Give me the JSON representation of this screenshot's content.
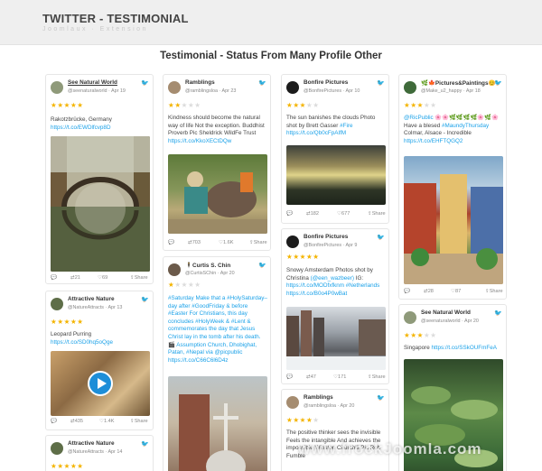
{
  "app": {
    "title": "TWITTER - TESTIMONIAL",
    "subtitle": "Joomlaux · Extension"
  },
  "heading": "Testimonial - Status From Many Profile Other",
  "cards": {
    "c1": {
      "name": "See Natural World",
      "handle": "@seenaturalworld",
      "date": "Apr 19",
      "stars": "★★★★★",
      "text": "Rakotzbrücke, Germany",
      "link": "https://t.co/EWDlfcvp8D",
      "retweets": "21",
      "likes": "69",
      "share": "Share"
    },
    "c2": {
      "name": "Attractive Nature",
      "handle": "@NatureAttracts",
      "date": "Apr 13",
      "stars": "★★★★★",
      "text": "Leopard Purring",
      "link": "https://t.co/SD0hq5oQge",
      "retweets": "435",
      "likes": "1.4K",
      "share": "Share"
    },
    "c3": {
      "name": "Attractive Nature",
      "handle": "@NatureAttracts",
      "date": "Apr 14",
      "stars": "★★★★★"
    },
    "c4": {
      "name": "Ramblings",
      "handle": "@ramblingsloa",
      "date": "Apr 23",
      "stars_on": "★★",
      "stars_off": "★★★",
      "text": "Kindness should become the natural way of life Not the exception. Buddhist Proverb Pic Sheldrick WildFe Trust",
      "link": "https://t.co/KkoXECtDQw",
      "retweets": "703",
      "likes": "1.6K",
      "share": "Share"
    },
    "c5": {
      "name": "Curtis S. Chin",
      "handle": "@CurtisSChin",
      "date": "Apr 20",
      "stars_on": "★",
      "stars_off": "★★★★",
      "text_a": "#Saturday Make that a #HolySaturday– day after #GoodFriday & before #Easter For Christians, this day concludes #HolyWeek & #Lent & commemorates the day that Jesus Christ lay in the tomb after his death. 🎬 Assumption Church, Dhobighat, Patan, #Nepal ",
      "text_b": "via @picpublic",
      "link": "https://t.co/C66C6l6D4z"
    },
    "c6": {
      "name": "Bonfire Pictures",
      "handle": "@BonfirePictures",
      "date": "Apr 10",
      "stars_on": "★★★",
      "stars_off": "★★",
      "text": "The sun banishes the clouds Photo shot by Brett Gasser ",
      "text_link": "#Fire",
      "link": "https://t.co/Qb0cFpAIfM",
      "retweets": "182",
      "likes": "677",
      "share": "Share"
    },
    "c7": {
      "name": "Bonfire Pictures",
      "handle": "@BonfirePictures",
      "date": "Apr 9",
      "stars": "★★★★★",
      "text": "Snowy Amsterdam Photos shot by Christina ",
      "text_link": "(@een_wazbeer)",
      "text_mid": " IG: ",
      "link": "https://t.co/MODfxfknm #Netherlands https://t.co/B0o4P0wBat",
      "retweets": "47",
      "likes": "171",
      "share": "Share"
    },
    "c8": {
      "name": "Ramblings",
      "handle": "@ramblingsloa",
      "date": "Apr 20",
      "stars_on": "★★★★",
      "stars_off": "★",
      "text": "The positive thinker sees the invisible Feels the intangible And achieves the impossible Winston Churchill Pic Rob Fumble"
    },
    "c9": {
      "name": "🌿🍁Pictures&Paintings😊",
      "handle": "@Make_u2_happy",
      "date": "Apr 18",
      "stars_on": "★★★",
      "stars_off": "★★",
      "text_a": "@RicPublic ",
      "text_b": "🌸🌸🌿🌿🌿🌿🌸🌿🌸",
      "text_c": " Have a blesed ",
      "text_d": "#MaundyThursday",
      "text_e": " Colmar, Alsace - Incredible",
      "link": "https://t.co/EHFTQGQ2",
      "retweets": "28",
      "likes": "87",
      "share": "Share"
    },
    "c10": {
      "name": "See Natural World",
      "handle": "@seenaturalworld",
      "date": "Apr 20",
      "stars_on": "★★★",
      "stars_off": "★★",
      "text": "Singapore ",
      "link": "https://t.co/SSkOUFmFeA"
    }
  },
  "watermark": "www.frockJoomla.com",
  "colors": {
    "accent": "#1aa1e8",
    "star": "#f4b400",
    "topbar": "#efefef"
  }
}
